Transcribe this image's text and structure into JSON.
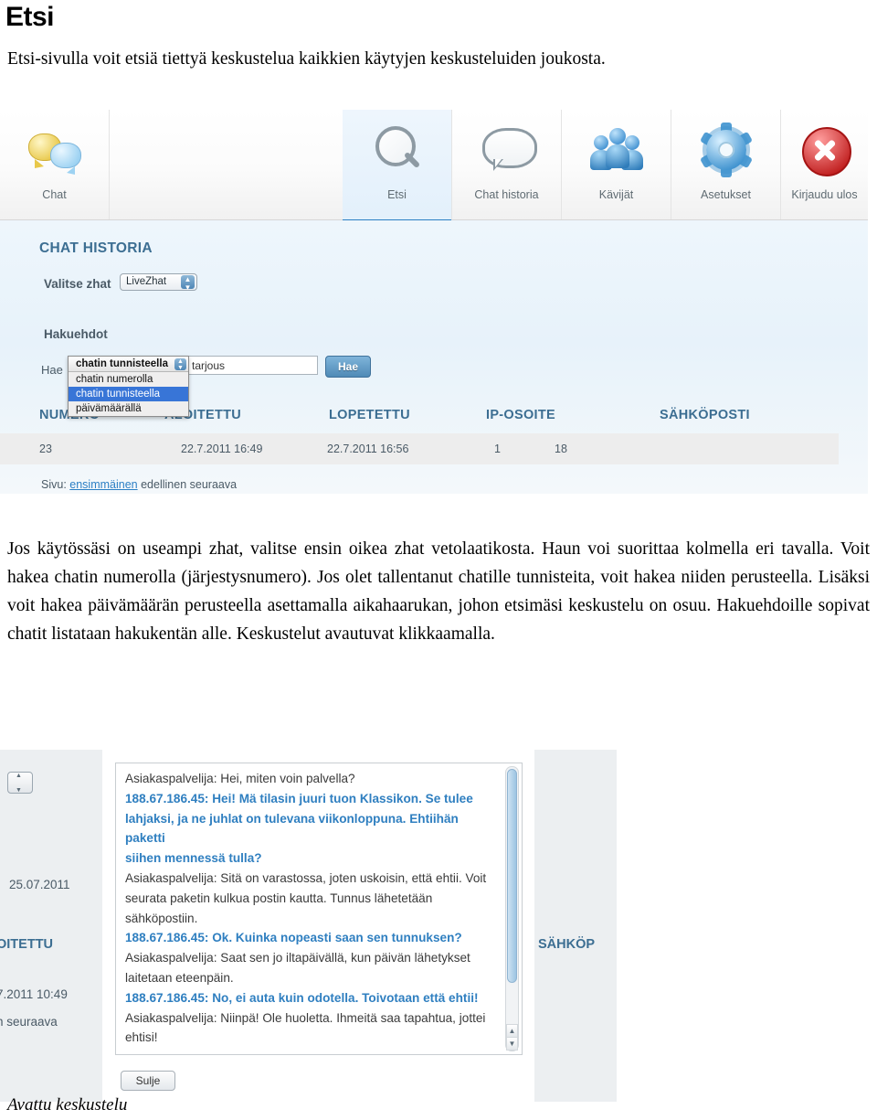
{
  "page": {
    "title": "Etsi",
    "intro": "Etsi-sivulla voit etsiä tiettyä keskustelua kaikkien käytyjen keskusteluiden joukosta.",
    "paragraph": "Jos käytössäsi on useampi zhat, valitse ensin oikea zhat vetolaatikosta. Haun voi suorittaa kolmella eri tavalla. Voit hakea chatin numerolla (järjestysnumero). Jos olet tallentanut chatille tunnisteita, voit hakea niiden perusteella. Lisäksi voit hakea päivämäärän perusteella asettamalla aikahaarukan, johon etsimäsi keskustelu on osuu. Hakuehdoille sopivat chatit listataan hakukentän alle. Keskustelut avautuvat klikkaamalla.",
    "caption": "Avattu keskustelu"
  },
  "screenshot1": {
    "toolbar": [
      {
        "label": "Chat",
        "icon": "chat-bubbles-icon",
        "active": false
      },
      {
        "label": "Etsi",
        "icon": "search-icon",
        "active": true
      },
      {
        "label": "Chat historia",
        "icon": "speech-bubble-icon",
        "active": false
      },
      {
        "label": "Kävijät",
        "icon": "users-icon",
        "active": false
      },
      {
        "label": "Asetukset",
        "icon": "gear-icon",
        "active": false
      },
      {
        "label": "Kirjaudu ulos",
        "icon": "close-circle-icon",
        "active": false
      }
    ],
    "section_title": "CHAT HISTORIA",
    "select_zhat_label": "Valitse zhat",
    "select_zhat_value": "LiveZhat",
    "search_conditions_label": "Hakuehdot",
    "hae_label": "Hae",
    "criteria_selected": "chatin tunnisteella",
    "criteria_options": [
      "chatin numerolla",
      "chatin tunnisteella",
      "päivämäärällä"
    ],
    "criteria_highlighted": "chatin tunnisteella",
    "query_value": "tarjous",
    "search_button": "Hae",
    "table_headers": [
      "NUMERO",
      "ALOITETTU",
      "LOPETETTU",
      "IP-OSOITE",
      "SÄHKÖPOSTI"
    ],
    "table_row": [
      "23",
      "22.7.2011 16:49",
      "22.7.2011 16:56",
      "1",
      "18"
    ],
    "paging_label": "Sivu:",
    "paging_links": [
      "ensimmäinen",
      "edellinen",
      "seuraava"
    ]
  },
  "screenshot2": {
    "left_date": "25.07.2011",
    "left_header": "OITETTU",
    "left_time": "7.2011 10:49",
    "left_paging": "n seuraava",
    "right_header": "SÄHKÖP",
    "close_button": "Sulje",
    "chat_lines": [
      {
        "speaker": "agent",
        "text": "Asiakaspalvelija: Hei, miten voin palvella?"
      },
      {
        "speaker": "customer",
        "text": "188.67.186.45: Hei! Mä tilasin juuri tuon Klassikon. Se tulee"
      },
      {
        "speaker": "customer",
        "text": "lahjaksi, ja ne juhlat on tulevana viikonloppuna. Ehtiihän paketti"
      },
      {
        "speaker": "customer",
        "text": "siihen mennessä tulla?"
      },
      {
        "speaker": "agent",
        "text": "Asiakaspalvelija: Sitä on varastossa, joten uskoisin, että ehtii. Voit"
      },
      {
        "speaker": "agent",
        "text": "seurata paketin kulkua postin kautta. Tunnus lähetetään"
      },
      {
        "speaker": "agent",
        "text": "sähköpostiin."
      },
      {
        "speaker": "customer",
        "text": "188.67.186.45: Ok. Kuinka nopeasti saan sen tunnuksen?"
      },
      {
        "speaker": "agent",
        "text": "Asiakaspalvelija: Saat sen jo iltapäivällä, kun päivän lähetykset"
      },
      {
        "speaker": "agent",
        "text": "laitetaan eteenpäin."
      },
      {
        "speaker": "customer",
        "text": "188.67.186.45: No, ei auta kuin odotella. Toivotaan että ehtii!"
      },
      {
        "speaker": "agent",
        "text": "Asiakaspalvelija: Niinpä! Ole huoletta. Ihmeitä saa tapahtua, jottei"
      },
      {
        "speaker": "agent",
        "text": "ehtisi!"
      }
    ]
  },
  "colors": {
    "accent": "#2b7fc4",
    "heading": "#3c6e92",
    "customer_text": "#2f7fc0"
  }
}
